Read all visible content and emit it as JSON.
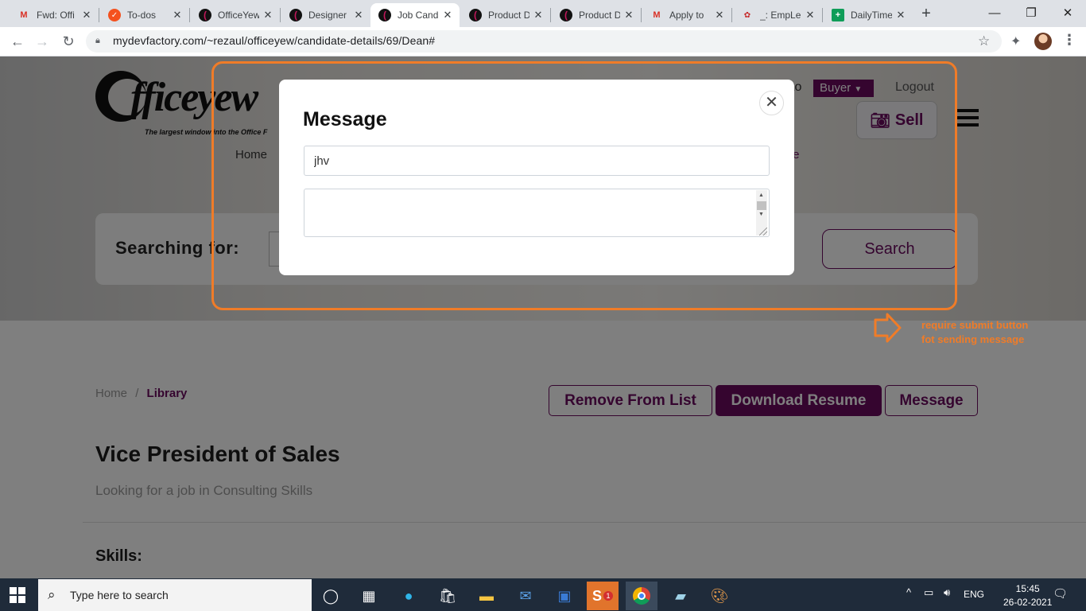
{
  "browser": {
    "tabs": [
      {
        "label": "Fwd: Offi",
        "icon": "gmail-icon"
      },
      {
        "label": "To-dos",
        "icon": "todo-icon"
      },
      {
        "label": "OfficeYew",
        "icon": "officeyew-icon"
      },
      {
        "label": "Designer",
        "icon": "officeyew-icon"
      },
      {
        "label": "Job Cand",
        "icon": "officeyew-icon",
        "active": true
      },
      {
        "label": "Product D",
        "icon": "officeyew-icon"
      },
      {
        "label": "Product D",
        "icon": "officeyew-icon"
      },
      {
        "label": "Apply to",
        "icon": "gmail-icon"
      },
      {
        "label": "_: EmpLe",
        "icon": "emple-icon"
      },
      {
        "label": "DailyTime",
        "icon": "sheets-icon"
      }
    ],
    "url": "mydevfactory.com/~rezaul/officeyew/candidate-details/69/Dean#"
  },
  "site": {
    "logo_text": "fficeyew",
    "logo_tagline": "The largest window into the Office F",
    "switch_to": "to",
    "buyer_label": "Buyer",
    "logout_label": "Logout",
    "sell_label": "Sell",
    "nav_home": "Home",
    "nav_last": "te",
    "searching_label": "Searching for:",
    "search_button": "Search"
  },
  "breadcrumb": {
    "home": "Home",
    "separator": "/",
    "current": "Library"
  },
  "actions": {
    "remove": "Remove From List",
    "download": "Download Resume",
    "message": "Message"
  },
  "candidate": {
    "title": "Vice President of Sales",
    "subtitle": "Looking for a job in Consulting Skills",
    "skills_heading": "Skills:"
  },
  "modal": {
    "title": "Message",
    "subject_value": "jhv",
    "body_value": "",
    "close_symbol": "✕"
  },
  "annotation": {
    "line1": "require submit button",
    "line2": "fot sending message",
    "color": "#f07c28"
  },
  "taskbar": {
    "search_placeholder": "Type here to search",
    "language": "ENG",
    "time": "15:45",
    "date": "26-02-2021",
    "badge_count": "1"
  },
  "colors": {
    "brand": "#6a0a5e",
    "highlight": "#f07c28"
  }
}
